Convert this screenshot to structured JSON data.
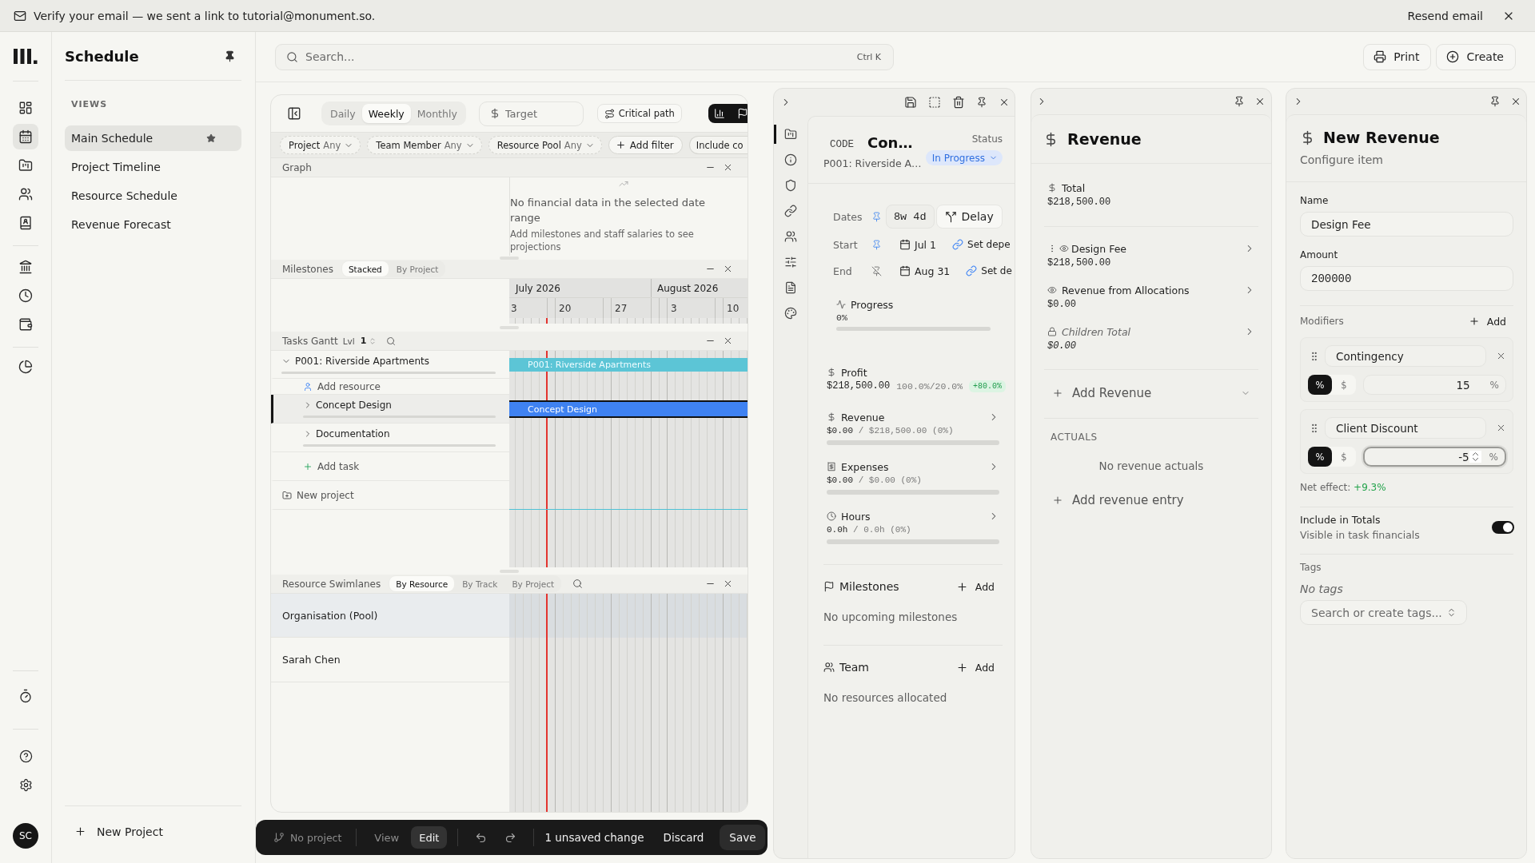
{
  "banner": {
    "message": "Verify your email — we sent a link to tutorial@monument.so.",
    "action": "Resend email"
  },
  "nav_rail": {
    "main": [
      {
        "selected": false
      },
      {
        "selected": true
      },
      {
        "selected": false
      },
      {
        "selected": false
      },
      {
        "selected": false
      }
    ],
    "finance": [
      {
        "selected": false
      },
      {
        "selected": false
      },
      {
        "selected": false
      }
    ],
    "reports": [
      {
        "selected": false
      }
    ],
    "tools": [
      {
        "selected": false
      }
    ],
    "avatar": "SC"
  },
  "sidebar": {
    "title": "Schedule",
    "section": "VIEWS",
    "views": [
      {
        "label": "Main Schedule",
        "selected": true,
        "starred": true
      },
      {
        "label": "Project Timeline",
        "selected": false,
        "starred": false
      },
      {
        "label": "Resource Schedule",
        "selected": false,
        "starred": false
      },
      {
        "label": "Revenue Forecast",
        "selected": false,
        "starred": false
      }
    ],
    "new_project": "New Project"
  },
  "header": {
    "search": {
      "placeholder": "Search...",
      "shortcut": "Ctrl K"
    },
    "buttons": [
      {
        "kind": "print",
        "label": "Print"
      },
      {
        "kind": "create",
        "label": "Create"
      }
    ]
  },
  "gantt": {
    "views": [
      {
        "label": "Daily",
        "selected": false
      },
      {
        "label": "Weekly",
        "selected": true
      },
      {
        "label": "Monthly",
        "selected": false
      }
    ],
    "target": {
      "placeholder": "Target"
    },
    "critical_path": "Critical path",
    "filters": [
      {
        "label": "Project",
        "value": "Any"
      },
      {
        "label": "Team Member",
        "value": "Any"
      },
      {
        "label": "Resource Pool",
        "value": "Any"
      }
    ],
    "add_filter": "Add filter",
    "include_chip": "Include co",
    "graph": {
      "title": "Graph",
      "empty_title": "No financial data in the selected date range",
      "empty_hint": "Add milestones and staff salaries to see projections"
    },
    "milestones": {
      "title": "Milestones",
      "modes": [
        {
          "label": "Stacked",
          "selected": true
        },
        {
          "label": "By Project",
          "selected": false
        }
      ],
      "months": [
        "July 2026",
        "August 2026"
      ],
      "days": [
        "3",
        "20",
        "27",
        "3",
        "10"
      ]
    },
    "tasks": {
      "title": "Tasks Gantt",
      "lvl_label": "Lvl",
      "lvl_value": "1",
      "rows": [
        {
          "kind": "project",
          "name": "P001: Riverside Apartments",
          "expanded": true,
          "selected": false,
          "bar_label": "P001: Riverside Apartments",
          "children": [
            {
              "kind": "add_resource",
              "label": "Add resource"
            },
            {
              "kind": "task",
              "name": "Concept Design",
              "expanded": false,
              "selected": true,
              "bar_label": "Concept Design"
            },
            {
              "kind": "task",
              "name": "Documentation",
              "expanded": false,
              "selected": false
            },
            {
              "kind": "add_task",
              "label": "Add task"
            }
          ]
        },
        {
          "kind": "add_project",
          "label": "New project"
        }
      ]
    },
    "swimlanes": {
      "title": "Resource Swimlanes",
      "modes": [
        {
          "label": "By Resource",
          "selected": true
        },
        {
          "label": "By Track",
          "selected": false
        },
        {
          "label": "By Project",
          "selected": false
        }
      ],
      "lanes": [
        {
          "name": "Organisation (Pool)",
          "kind": "pool"
        },
        {
          "name": "Sarah Chen",
          "kind": "person"
        }
      ]
    }
  },
  "action_bar": {
    "project": "No project",
    "modes": [
      {
        "label": "View",
        "selected": false
      },
      {
        "label": "Edit",
        "selected": true
      }
    ],
    "status": "1 unsaved change",
    "discard": "Discard",
    "save": "Save"
  },
  "task_panel": {
    "tabs": [
      {
        "selected": true
      },
      {
        "selected": false
      },
      {
        "selected": false
      },
      {
        "selected": false
      },
      {
        "selected": false
      },
      {
        "selected": false
      },
      {
        "selected": false
      },
      {
        "selected": false
      }
    ],
    "code_label": "CODE",
    "title": "Con…",
    "project": "P001: Riverside A…",
    "status_label": "Status",
    "status": "In Progress",
    "schedule": [
      {
        "kind": "duration",
        "label": "Dates",
        "pinned": true,
        "duration": "8w 4d",
        "action": "Delay"
      },
      {
        "kind": "date",
        "label": "Start",
        "pinned": true,
        "date": "Jul 1",
        "dependency": "Set depe"
      },
      {
        "kind": "date",
        "label": "End",
        "pinned": false,
        "date": "Aug 31",
        "dependency": "Set de"
      }
    ],
    "progress": {
      "label": "Progress",
      "value": "0%"
    },
    "metrics": [
      {
        "kind": "profit",
        "label": "Profit",
        "amount": "$218,500.00",
        "ratio": "100.0%/20.0%",
        "badge": "+80.0%"
      },
      {
        "kind": "revenue",
        "label": "Revenue",
        "actual": "$0.00",
        "separator": "/",
        "total": "$218,500.00",
        "percent": "(0%)"
      },
      {
        "kind": "expenses",
        "label": "Expenses",
        "actual": "$0.00",
        "separator": "/",
        "total": "$0.00",
        "percent": "(0%)"
      },
      {
        "kind": "hours",
        "label": "Hours",
        "actual": "0.0h",
        "separator": "/",
        "total": "0.0h",
        "percent": "(0%)"
      }
    ],
    "sections": [
      {
        "kind": "milestones",
        "title": "Milestones",
        "add": "Add",
        "empty": "No upcoming milestones"
      },
      {
        "kind": "team",
        "title": "Team",
        "add": "Add",
        "empty": "No resources allocated"
      }
    ]
  },
  "revenue_panel": {
    "title": "Revenue",
    "total": {
      "label": "Total",
      "value": "$218,500.00"
    },
    "items": [
      {
        "kind": "custom",
        "label": "Design Fee",
        "value": "$218,500.00"
      },
      {
        "kind": "allocation",
        "label": "Revenue from Allocations",
        "value": "$0.00"
      },
      {
        "kind": "rollup",
        "label": "Children Total",
        "value": "$0.00"
      }
    ],
    "add": "Add Revenue",
    "actuals_heading": "ACTUALS",
    "actuals_empty": "No revenue actuals",
    "add_entry": "Add revenue entry"
  },
  "new_revenue_panel": {
    "title": "New Revenue",
    "subtitle": "Configure item",
    "fields": [
      {
        "kind": "text",
        "label": "Name",
        "value": "Design Fee"
      },
      {
        "kind": "number",
        "label": "Amount",
        "value": "200000"
      }
    ],
    "modifiers_label": "Modifiers",
    "add": "Add",
    "modifiers": [
      {
        "name": "Contingency",
        "units": [
          {
            "label": "%",
            "selected": true
          },
          {
            "label": "$",
            "selected": false
          }
        ],
        "value": "15",
        "suffix": "%",
        "focused": false
      },
      {
        "name": "Client Discount",
        "units": [
          {
            "label": "%",
            "selected": true
          },
          {
            "label": "$",
            "selected": false
          }
        ],
        "value": "-5",
        "suffix": "%",
        "focused": true
      }
    ],
    "net_effect_label": "Net effect:",
    "net_effect": "+9.3%",
    "include": {
      "label": "Include in Totals",
      "hint": "Visible in task financials",
      "on": true
    },
    "tags_label": "Tags",
    "tags_empty": "No tags",
    "tags_search": {
      "placeholder": "Search or create tags..."
    }
  }
}
